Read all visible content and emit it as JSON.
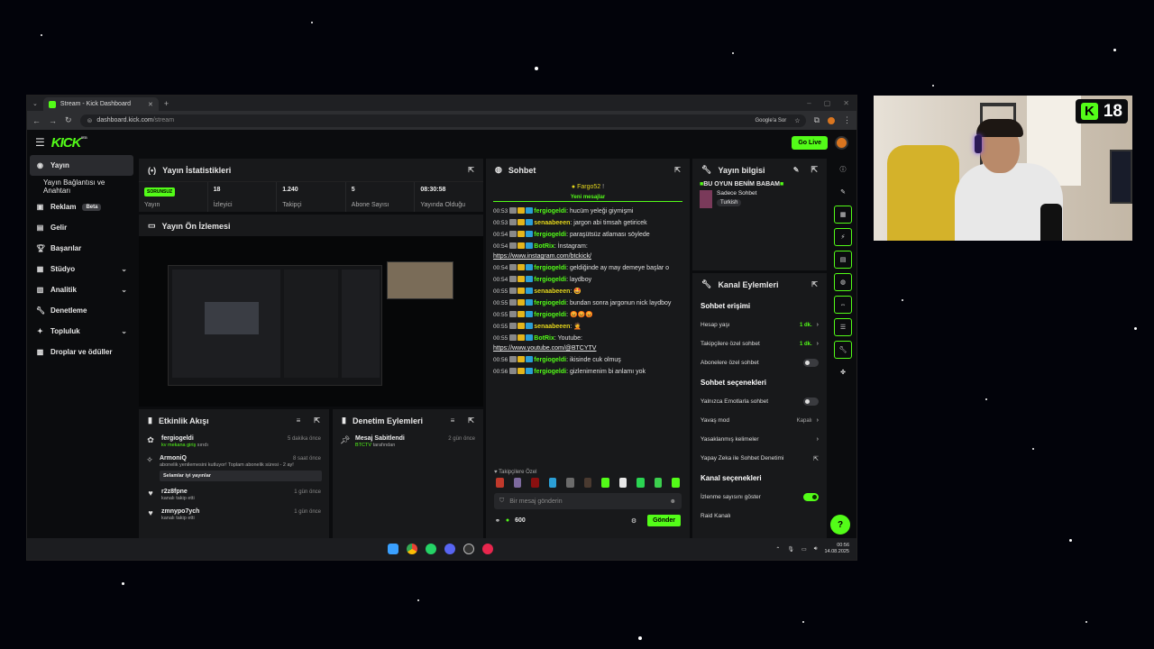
{
  "browser": {
    "tab_title": "Stream - Kick Dashboard",
    "url_host": "dashboard.kick.com",
    "url_path": "/stream",
    "google_btn": "Google'a Sor"
  },
  "header": {
    "logo": "KICK",
    "logo_sup": "BETA",
    "go_live": "Go Live"
  },
  "sidebar": {
    "items": [
      {
        "label": "Yayın"
      },
      {
        "label": "Yayın Bağlantısı ve Anahtarı"
      },
      {
        "label": "Reklam",
        "badge": "Beta"
      },
      {
        "label": "Gelir"
      },
      {
        "label": "Başarılar"
      },
      {
        "label": "Stüdyo"
      },
      {
        "label": "Analitik"
      },
      {
        "label": "Denetleme"
      },
      {
        "label": "Topluluk"
      },
      {
        "label": "Droplar ve ödüller"
      }
    ]
  },
  "stats": {
    "title": "Yayın İstatistikleri",
    "badge": "SORUNSUZ",
    "items": [
      {
        "value": "",
        "label": "Yayın"
      },
      {
        "value": "18",
        "label": "İzleyici"
      },
      {
        "value": "1.240",
        "label": "Takipçi"
      },
      {
        "value": "5",
        "label": "Abone Sayısı"
      },
      {
        "value": "08:30:58",
        "label": "Yayında Olduğu"
      }
    ]
  },
  "preview": {
    "title": "Yayın Ön İzlemesi"
  },
  "activity": {
    "title": "Etkinlik Akışı",
    "items": [
      {
        "name": "fergiogeldi",
        "sub": "kv mekana giriş",
        "sub2": "sırıdı",
        "time": "5 dakika önce"
      },
      {
        "name": "ArmoniQ",
        "sub": "abonelik yenilemesini kutluyor! Toplam abonelik süresi - 2 ay!",
        "time": "8 saat önce",
        "msg": "Selamlar iyi yayınlar"
      },
      {
        "name": "r2z8fpne",
        "sub": "kanalı takip etti",
        "time": "1 gün önce"
      },
      {
        "name": "zmnypo7ych",
        "sub": "kanalı takip etti",
        "time": "1 gün önce"
      }
    ]
  },
  "moderation": {
    "title": "Denetim Eylemleri",
    "items": [
      {
        "title": "Mesaj Sabitlendi",
        "by": "BTCTV",
        "by_suffix": "tarafından",
        "time": "2 gün önce"
      }
    ]
  },
  "chat": {
    "title": "Sohbet",
    "pinned": "Fargo52",
    "new_messages": "Yeni mesajlar",
    "messages": [
      {
        "time": "00:53",
        "user": "fergiogeldi",
        "text": "hucüm yeleği giymişmi"
      },
      {
        "time": "00:53",
        "user": "senaabeeen",
        "text": "jargon abi timsah getiricek"
      },
      {
        "time": "00:54",
        "user": "fergiogeldi",
        "text": "paraşütsüz atlaması söylede"
      },
      {
        "time": "00:54",
        "user": "BotRix",
        "text": "İnstagram:",
        "link": "https://www.instagram.com/btckick/"
      },
      {
        "time": "00:54",
        "user": "fergiogeldi",
        "text": "geldiğinde ay may demeye başlar o"
      },
      {
        "time": "00:54",
        "user": "fergiogeldi",
        "text": "laydboy"
      },
      {
        "time": "00:55",
        "user": "senaabeeen",
        "text": "🤩"
      },
      {
        "time": "00:55",
        "user": "fergiogeldi",
        "text": "bundan sonra jargonun nick laydboy"
      },
      {
        "time": "00:55",
        "user": "fergiogeldi",
        "text": "😡😡😡"
      },
      {
        "time": "00:55",
        "user": "senaabeeen",
        "text": "🤦"
      },
      {
        "time": "00:55",
        "user": "BotRix",
        "text": "Youtube:",
        "link": "https://www.youtube.com/@BTCYTV"
      },
      {
        "time": "00:56",
        "user": "fergiogeldi",
        "text": "ikisinde cuk olmuş"
      },
      {
        "time": "00:56",
        "user": "fergiogeldi",
        "text": "gizlenimenim bi anlamı yok"
      }
    ],
    "followers_only": "Takipçilere Özel",
    "input_placeholder": "Bir mesaj gönderin",
    "points": "600",
    "send": "Gönder"
  },
  "stream_info": {
    "title": "Yayın bilgisi",
    "stream_title": "BU OYUN BENİM BABAM",
    "category": "Sadece Sohbet",
    "tag": "Turkish"
  },
  "channel_actions": {
    "title": "Kanal Eylemleri",
    "chat_access": "Sohbet erişimi",
    "account_age": "Hesap yaşı",
    "account_age_val": "1 dk.",
    "followers_chat": "Takipçilere özel sohbet",
    "followers_chat_val": "1 dk.",
    "subs_chat": "Abonelere özel sohbet",
    "chat_options": "Sohbet seçenekleri",
    "emotes_only": "Yalnızca Emotlarla sohbet",
    "slow_mode": "Yavaş mod",
    "slow_mode_val": "Kapalı",
    "banned_words": "Yasaklanmış kelimeler",
    "ai_moderation": "Yapay Zeka ile Sohbet Denetimi",
    "channel_options": "Kanal seçenekleri",
    "show_viewers": "İzlenme sayısını göster",
    "raid": "Raid Kanalı"
  },
  "taskbar": {
    "time": "00:56",
    "date": "14.08.2025"
  },
  "webcam": {
    "age_rating": "18"
  },
  "colors": {
    "accent": "#53fc18",
    "bg": "#0b0c0e",
    "panel": "#18191b"
  }
}
